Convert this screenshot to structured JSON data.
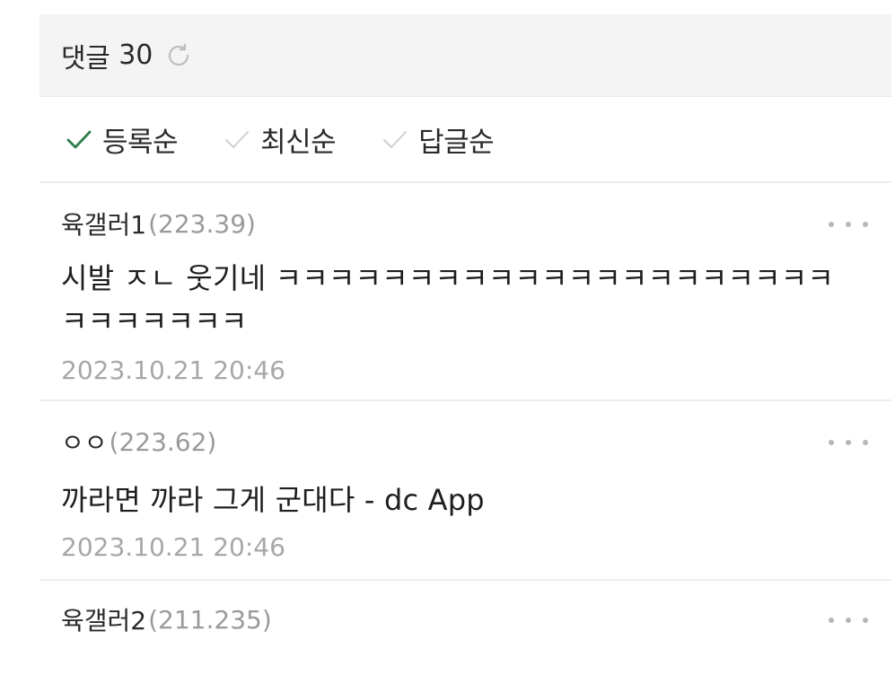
{
  "header": {
    "title": "댓글",
    "count": "30",
    "refresh_icon": "refresh-icon"
  },
  "sort": {
    "options": [
      {
        "label": "등록순",
        "active": true
      },
      {
        "label": "최신순",
        "active": false
      },
      {
        "label": "답글순",
        "active": false
      }
    ],
    "active_color": "#2e7d4f",
    "inactive_color": "#c8c8c8"
  },
  "comments": [
    {
      "nick": "육갤러1",
      "ip": "(223.39)",
      "body": "시발 ㅈㄴ 웃기네 ㅋㅋㅋㅋㅋㅋㅋㅋㅋㅋㅋㅋㅋㅋㅋㅋㅋㅋㅋㅋㅋㅋㅋㅋㅋㅋㅋㅋ",
      "date": "2023.10.21 20:46"
    },
    {
      "nick": "ㅇㅇ",
      "ip": "(223.62)",
      "body": "까라면 까라 그게 군대다 - dc App",
      "date": "2023.10.21 20:46"
    },
    {
      "nick": "육갤러2",
      "ip": "(211.235)"
    }
  ],
  "icons": {
    "more": "more-options-icon",
    "check": "check-icon"
  }
}
